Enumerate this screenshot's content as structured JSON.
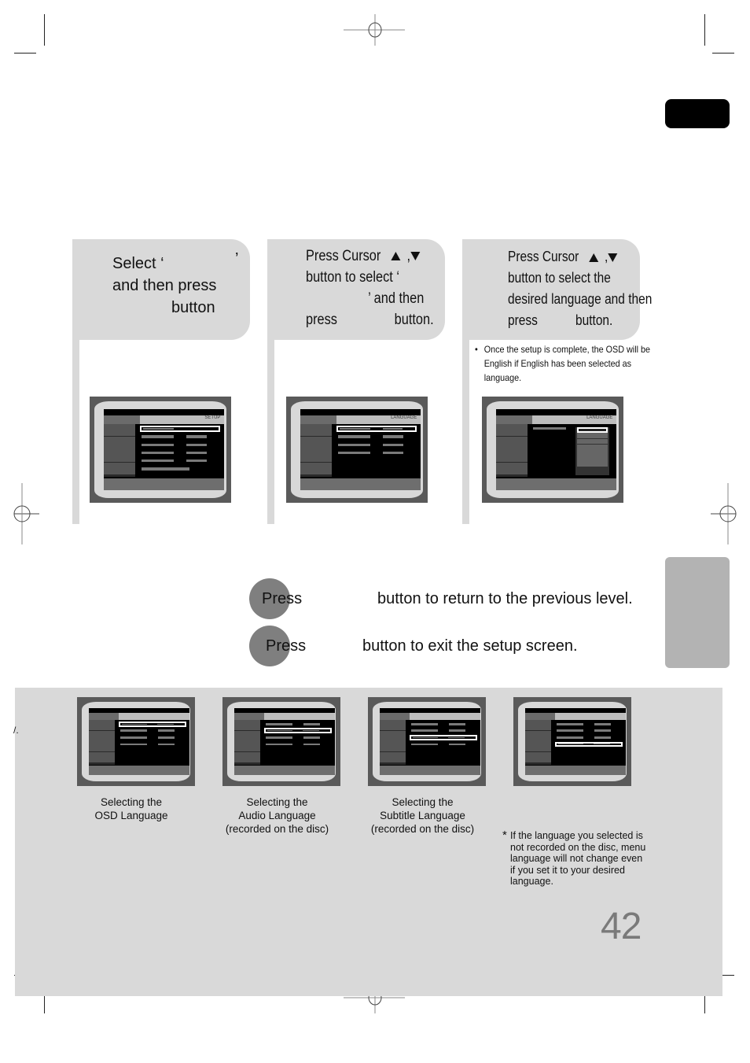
{
  "steps": [
    {
      "id": 1,
      "lines": [
        "Select ‘",
        "’",
        "and then press",
        "button"
      ]
    },
    {
      "id": 2,
      "lines": [
        "Press Cursor",
        ",",
        "button to select ‘",
        "’ and then",
        "press",
        "button."
      ]
    },
    {
      "id": 3,
      "lines": [
        "Press Cursor",
        ",",
        "button to select the",
        "desired language and then",
        "press",
        "button."
      ],
      "note": "Once the setup is complete, the OSD will be English if English has been selected as language."
    }
  ],
  "screens": {
    "step1": {
      "title": "SETUP",
      "highlighted_row": 1,
      "rows": 6
    },
    "step2": {
      "title": "LANGUAGE",
      "highlighted_row": 1,
      "rows": 4
    },
    "step3": {
      "title": "LANGUAGE",
      "highlighted_item": 1,
      "items": 7
    }
  },
  "instructions": {
    "return": {
      "press": "Press",
      "text": "button to return to the previous level."
    },
    "exit": {
      "press": "Press",
      "text": "button to exit the setup screen."
    }
  },
  "bottom": {
    "left_fragment": "/.",
    "captions": [
      {
        "lines": [
          "Selecting the",
          "OSD Language"
        ]
      },
      {
        "lines": [
          "Selecting the",
          "Audio Language",
          "(recorded on the disc)"
        ]
      },
      {
        "lines": [
          "Selecting the",
          "Subtitle Language",
          "(recorded on the disc)"
        ]
      }
    ],
    "footnote_marker": "*",
    "footnote": [
      "If the language you selected is",
      "not recorded on the disc, menu",
      "language will not change even",
      "if you set it to your desired",
      "language."
    ]
  },
  "page_number": "42",
  "colors": {
    "panel_gray": "#d9d9d9",
    "tab_black": "#000000",
    "tab_gray": "#b3b3b3",
    "circle_gray": "#7f7f7f",
    "page_number": "#7a7a7a"
  }
}
